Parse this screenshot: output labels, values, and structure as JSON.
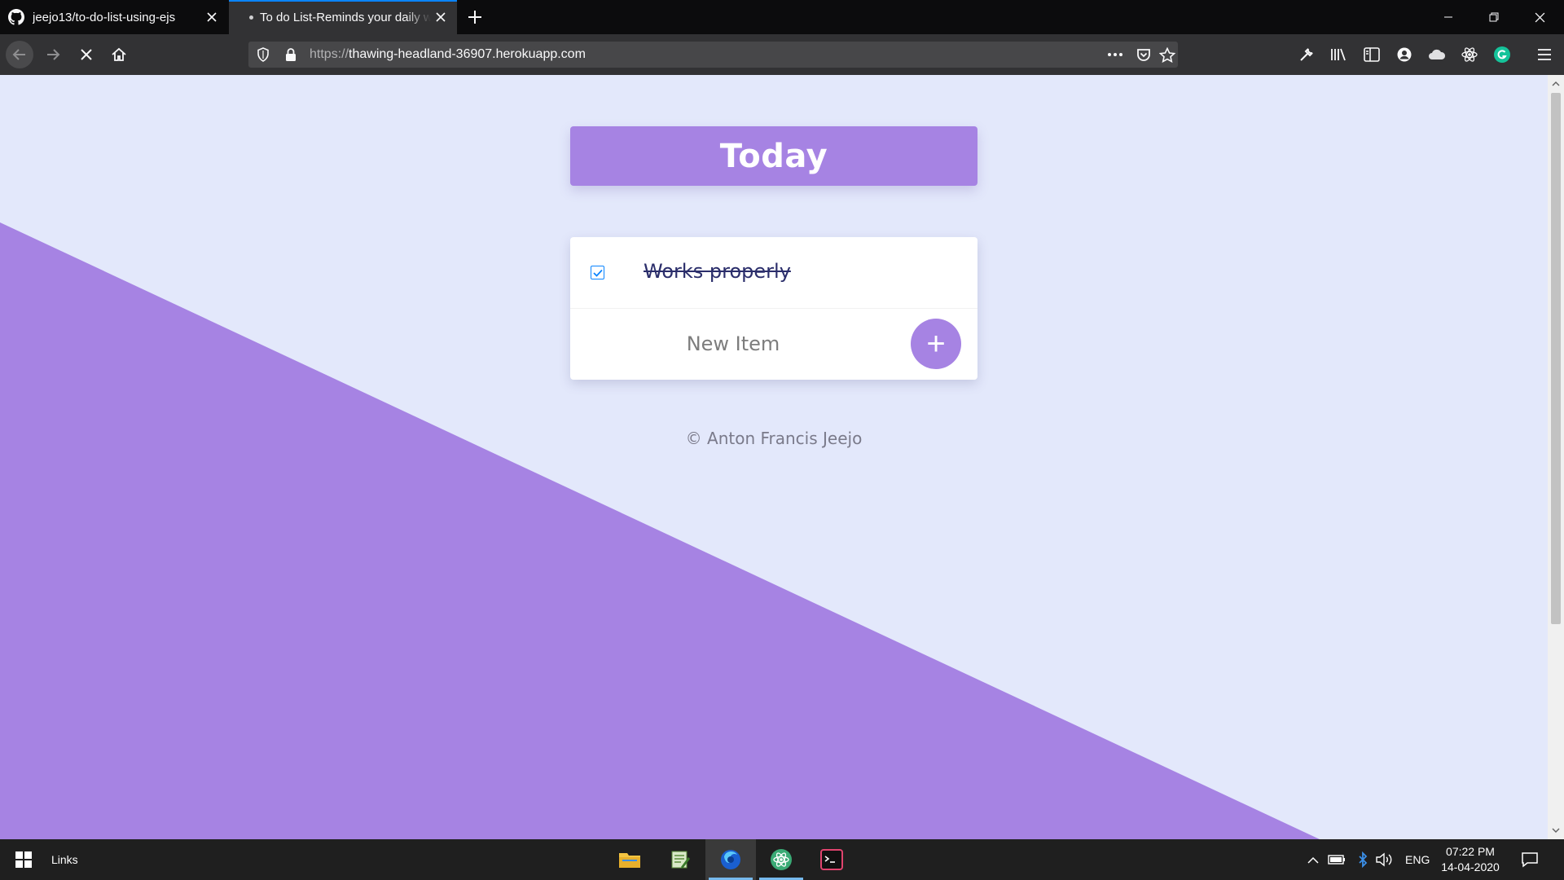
{
  "browser": {
    "tabs": [
      {
        "title": "jeejo13/to-do-list-using-ejs",
        "icon": "github-icon"
      },
      {
        "title": "To do List-Reminds your daily work",
        "icon": "loading-dot"
      }
    ],
    "url": {
      "scheme": "https://",
      "host": "thawing-headland-36907.herokuapp.com"
    }
  },
  "page": {
    "heading": "Today",
    "items": [
      {
        "text": "Works properly",
        "checked": true
      }
    ],
    "new_item_placeholder": "New Item",
    "add_button_label": "+",
    "footer": "© Anton Francis Jeejo"
  },
  "colors": {
    "accent": "#a683e3",
    "background": "#e3e8fb",
    "item_text": "#2b2e6b"
  },
  "taskbar": {
    "links_label": "Links",
    "language": "ENG",
    "time": "07:22 PM",
    "date": "14-04-2020"
  }
}
